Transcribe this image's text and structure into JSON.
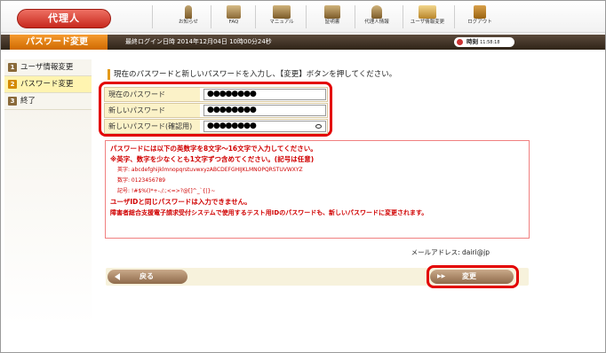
{
  "header": {
    "role_button": "代理人",
    "tools": [
      {
        "label": "お知らせ",
        "icon": "info-icon"
      },
      {
        "label": "FAQ",
        "icon": "faq-icon"
      },
      {
        "label": "マニュアル",
        "icon": "manual-icon"
      },
      {
        "label": "証明書",
        "icon": "certificate-icon"
      },
      {
        "label": "代理人情報",
        "icon": "agent-info-icon"
      },
      {
        "label": "ユーザ情報変更",
        "icon": "user-info-icon"
      },
      {
        "label": "ログアウト",
        "icon": "logout-icon"
      }
    ],
    "page_title": "パスワード変更",
    "last_login": "最終ログイン日時 2014年12月04日 10時00分24秒",
    "timer_label": "時刻",
    "timer_value": "11:58:18"
  },
  "sidebar": {
    "items": [
      {
        "num": "1",
        "label": "ユーザ情報変更",
        "active": false
      },
      {
        "num": "2",
        "label": "パスワード変更",
        "active": true
      },
      {
        "num": "3",
        "label": "終了",
        "active": false
      }
    ]
  },
  "main": {
    "instruction": "現在のパスワードと新しいパスワードを入力し、【変更】ボタンを押してください。",
    "fields": [
      {
        "label": "現在のパスワード",
        "value": "●●●●●●●●"
      },
      {
        "label": "新しいパスワード",
        "value": "●●●●●●●●"
      },
      {
        "label": "新しいパスワード(確認用)",
        "value": "●●●●●●●●"
      }
    ],
    "rules": {
      "line1": "パスワードには以下の英数字を8文字〜16文字で入力してください。",
      "line2": "※英字、数字を少なくとも1文字ずつ含めてください。(記号は任意)",
      "alpha": "英字:  abcdefghijklmnopqrstuvwxyzABCDEFGHIJKLMNOPQRSTUVWXYZ",
      "digits": "数字:  0123456789",
      "symbols": "記号:  !#$%()*+-./:;<=>?@[]^_`{|}~",
      "line3": "ユーザIDと同じパスワードは入力できません。",
      "line4": "障害者総合支援電子請求受付システムで使用するテスト用IDのパスワードも、新しいパスワードに変更されます。"
    },
    "mail_address": "メールアドレス: dairi@jp",
    "back_button": "戻る",
    "change_button": "変更"
  },
  "colors": {
    "accent_red": "#e30000",
    "header_orange": "#cf6a00",
    "role_red": "#c7281d",
    "active_yellow": "#fff4b0"
  }
}
